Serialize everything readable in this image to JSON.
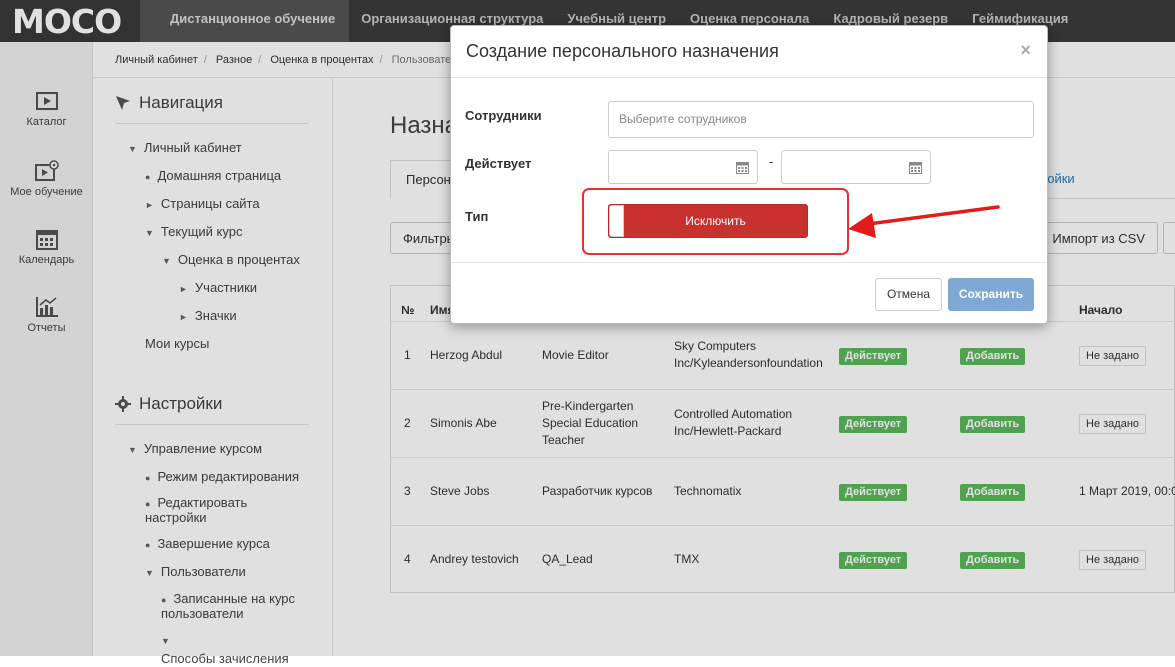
{
  "brand": {
    "logo": "MOCO"
  },
  "topnav": [
    "Дистанционное обучение",
    "Организационная структура",
    "Учебный центр",
    "Оценка персонала",
    "Кадровый резерв",
    "Геймификация"
  ],
  "rail": [
    {
      "label": "Каталог",
      "icon": "play-video-icon"
    },
    {
      "label": "Мое обучение",
      "icon": "my-learning-icon"
    },
    {
      "label": "Календарь",
      "icon": "calendar-icon"
    },
    {
      "label": "Отчеты",
      "icon": "chart-icon"
    }
  ],
  "breadcrumb": [
    "Личный кабинет",
    "Разное",
    "Оценка в процентах",
    "Пользовател"
  ],
  "nav": {
    "title": "Навигация",
    "items": [
      "Личный кабинет",
      "Домашняя страница",
      "Страницы сайта",
      "Текущий курс",
      "Оценка в процентах",
      "Участники",
      "Значки",
      "Мои курсы"
    ]
  },
  "settings": {
    "title": "Настройки",
    "items": [
      "Управление курсом",
      "Режим редактирования",
      "Редактировать настройки",
      "Завершение курса",
      "Пользователи",
      "Записанные на курс пользователи",
      "Способы зачисления"
    ]
  },
  "page": {
    "title": "Назна",
    "tab_active": "Персона",
    "tab_link": "ройки",
    "filters_button": "Фильтры",
    "import_button": "Импорт из CSV"
  },
  "table": {
    "headers": [
      "№",
      "Имя",
      "Начало"
    ],
    "rows": [
      {
        "n": "1",
        "name": "Herzog Abdul",
        "position": "Movie Editor",
        "org": "Sky Computers Inc/Kyleandersonfoundation",
        "status": "Действует",
        "action": "Добавить",
        "start": "Не задано"
      },
      {
        "n": "2",
        "name": "Simonis Abe",
        "position": "Pre-Kindergarten Special Education Teacher",
        "org": "Controlled Automation Inc/Hewlett-Packard",
        "status": "Действует",
        "action": "Добавить",
        "start": "Не задано"
      },
      {
        "n": "3",
        "name": "Steve Jobs",
        "position": "Разработчик курсов",
        "org": "Technomatix",
        "status": "Действует",
        "action": "Добавить",
        "start": "1 Март 2019, 00:0"
      },
      {
        "n": "4",
        "name": "Andrey testovich",
        "position": "QA_Lead",
        "org": "TMX",
        "status": "Действует",
        "action": "Добавить",
        "start": "Не задано"
      }
    ]
  },
  "modal": {
    "title": "Создание персонального назначения",
    "close": "×",
    "employees_label": "Сотрудники",
    "employees_placeholder": "Выберите сотрудников",
    "active_label": "Действует",
    "date_separator": "-",
    "type_label": "Тип",
    "type_toggle": "Исключить",
    "cancel": "Отмена",
    "save": "Сохранить"
  },
  "colors": {
    "topbar": "#3c3c3c",
    "toggle_red": "#c8312e",
    "highlight_red": "#e83030",
    "save_blue": "#7fa8d5",
    "status_green": "#5cb85c"
  }
}
